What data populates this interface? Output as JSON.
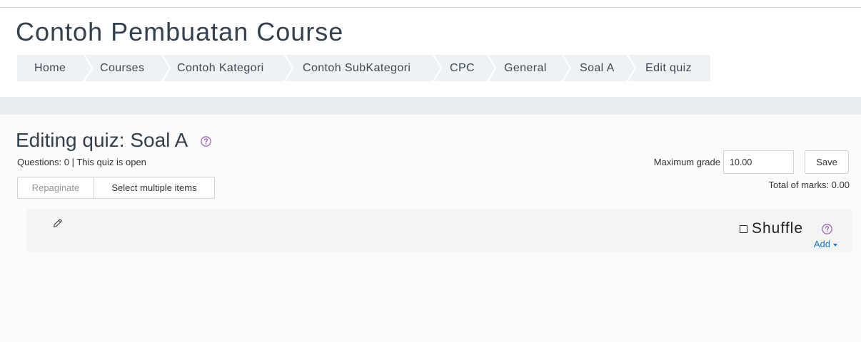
{
  "course": {
    "title": "Contoh Pembuatan Course"
  },
  "breadcrumb": {
    "items": [
      {
        "label": "Home"
      },
      {
        "label": "Courses"
      },
      {
        "label": "Contoh Kategori"
      },
      {
        "label": "Contoh SubKategori"
      },
      {
        "label": "CPC"
      },
      {
        "label": "General"
      },
      {
        "label": "Soal A"
      },
      {
        "label": "Edit quiz"
      }
    ],
    "separator_icon": "chevron-right-icon"
  },
  "quiz": {
    "heading": "Editing quiz: Soal A",
    "heading_help_icon": "help-icon",
    "status": "Questions: 0 | This quiz is open",
    "repaginate_label": "Repaginate",
    "repaginate_disabled": true,
    "select_multiple_label": "Select multiple items",
    "max_grade_label": "Maximum grade",
    "max_grade_value": "10.00",
    "save_label": "Save",
    "total_marks": "Total of marks: 0.00"
  },
  "section": {
    "edit_icon": "pencil-icon",
    "shuffle_label": "Shuffle",
    "shuffle_checked": false,
    "shuffle_help_icon": "help-icon",
    "add_label": "Add",
    "add_menu_icon": "caret-down-icon"
  },
  "colors": {
    "heading": "#33414f",
    "breadcrumb_bg": "#eef2f5",
    "band_bg": "#e8eef2",
    "help_icon": "#9b59b6",
    "link": "#1177d1",
    "section_bg": "#f4f4f4"
  }
}
